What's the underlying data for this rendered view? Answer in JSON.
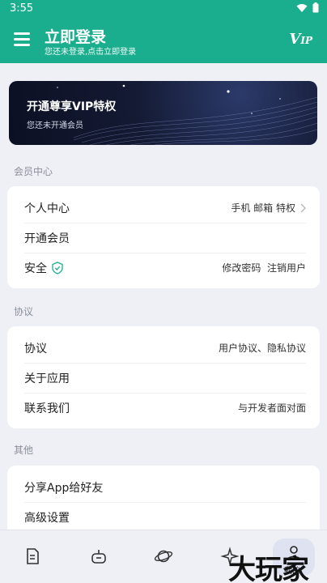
{
  "status_bar": {
    "time": "3:55"
  },
  "app_bar": {
    "title": "立即登录",
    "subtitle": "您还未登录,点击立即登录",
    "vip_logo": "V",
    "vip_logo_small": "IP"
  },
  "banner": {
    "title": "开通尊享VIP特权",
    "subtitle": "您还未开通会员"
  },
  "sections": {
    "member": {
      "label": "会员中心",
      "rows": [
        {
          "label": "个人中心",
          "value": "手机 邮箱 特权"
        },
        {
          "label": "开通会员",
          "value": ""
        },
        {
          "label": "安全",
          "value": "修改密码  注销用户"
        }
      ]
    },
    "agreement": {
      "label": "协议",
      "rows": [
        {
          "label": "协议",
          "value": "用户协议、隐私协议"
        },
        {
          "label": "关于应用",
          "value": ""
        },
        {
          "label": "联系我们",
          "value": "与开发者面对面"
        }
      ]
    },
    "other": {
      "label": "其他",
      "rows": [
        {
          "label": "分享App给好友",
          "value": ""
        },
        {
          "label": "高级设置",
          "value": ""
        }
      ]
    }
  },
  "bottom_nav": {
    "active_label": "我的"
  },
  "watermark": "大玩家",
  "colors": {
    "primary": "#1aae8f",
    "background": "#eef0f5",
    "card": "#ffffff"
  }
}
